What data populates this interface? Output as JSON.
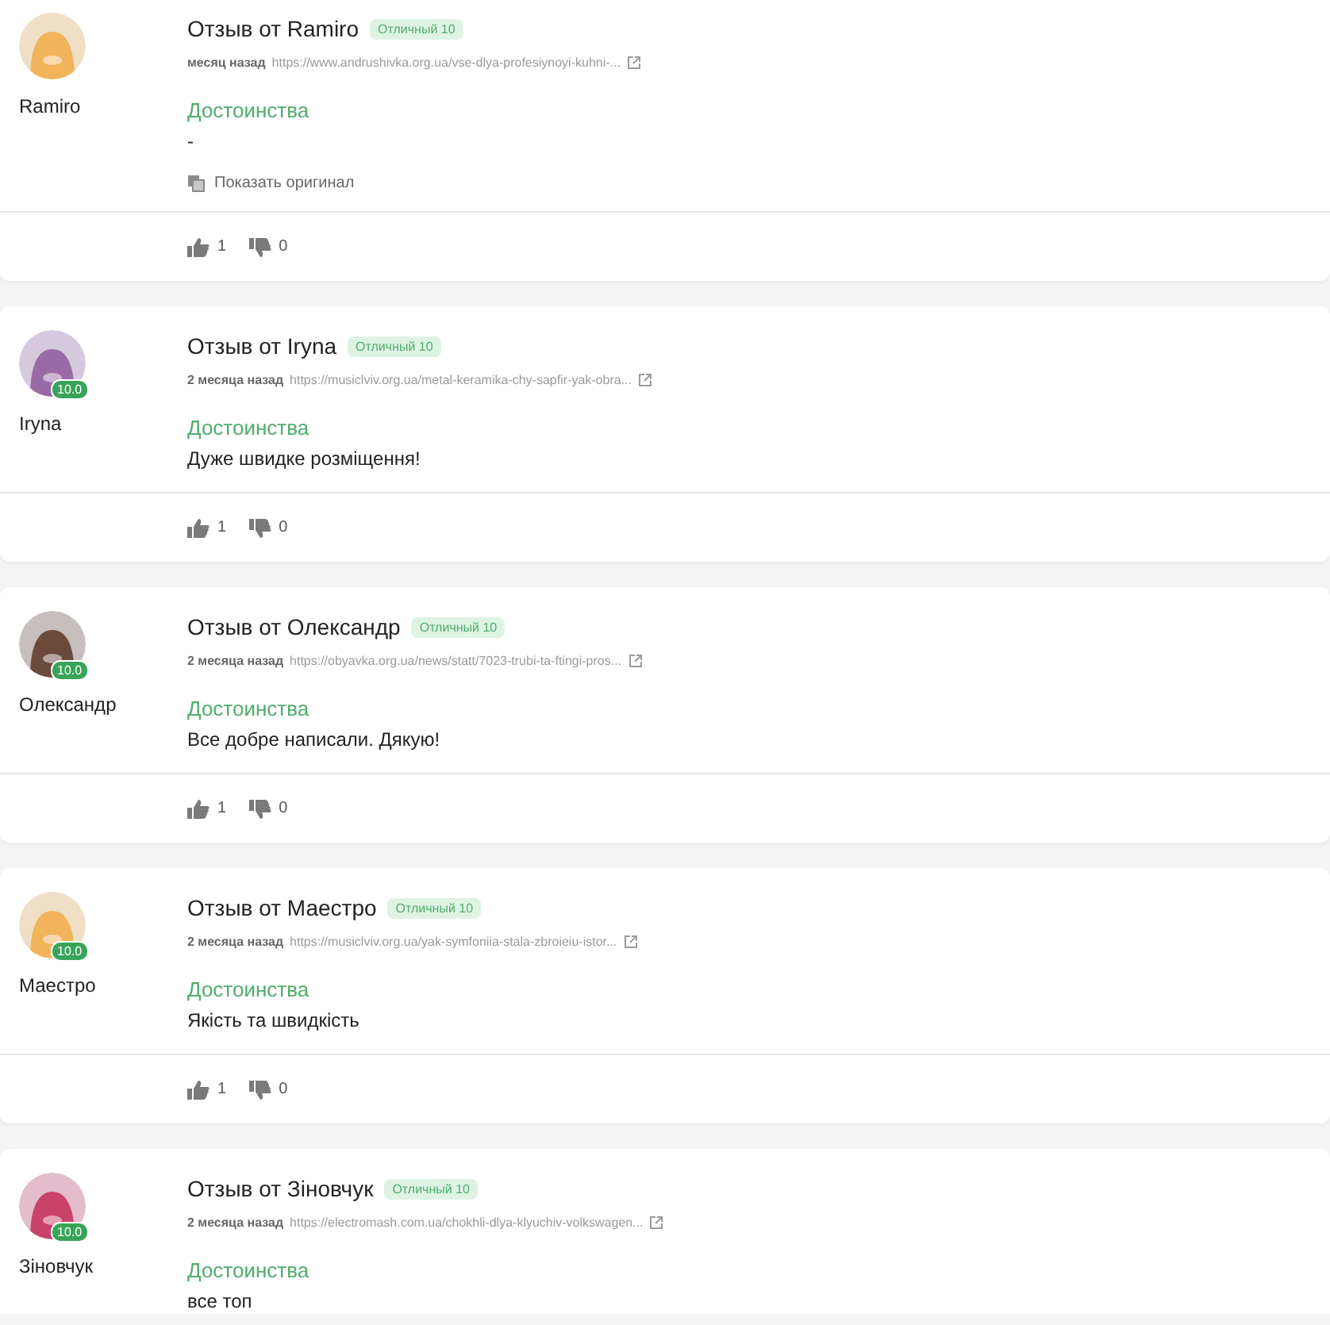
{
  "reviews": [
    {
      "author": "Ramiro",
      "avatar": {
        "color": "#f2b45a"
      },
      "title": "Отзыв от Ramiro",
      "badge": "Отличный 10",
      "time": "месяц назад",
      "url": "https://www.andrushivka.org.ua/vse-dlya-profesiynoyi-kuhni-...",
      "section": "Достоинства",
      "text": "-",
      "show_original": "Показать оригинал",
      "likes": "1",
      "dislikes": "0"
    },
    {
      "author": "Iryna",
      "avatar": {
        "color": "#9a6aa6",
        "score": "10.0"
      },
      "title": "Отзыв от Iryna",
      "badge": "Отличный 10",
      "time": "2 месяца назад",
      "url": "https://musiclviv.org.ua/metal-keramika-chy-sapfir-yak-obra...",
      "section": "Достоинства",
      "text": "Дуже швидке розміщення!",
      "likes": "1",
      "dislikes": "0"
    },
    {
      "author": "Олександр",
      "avatar": {
        "color": "#6a4a3a",
        "score": "10.0"
      },
      "title": "Отзыв от Олександр",
      "badge": "Отличный 10",
      "time": "2 месяца назад",
      "url": "https://obyavka.org.ua/news/statt/7023-trubi-ta-ftingi-pros...",
      "section": "Достоинства",
      "text": "Все добре написали. Дякую!",
      "likes": "1",
      "dislikes": "0"
    },
    {
      "author": "Маестро",
      "avatar": {
        "color": "#f2b45a",
        "score": "10.0"
      },
      "title": "Отзыв от Маестро",
      "badge": "Отличный 10",
      "time": "2 месяца назад",
      "url": "https://musiclviv.org.ua/yak-symfoniia-stala-zbroieiu-istor...",
      "section": "Достоинства",
      "text": "Якість та швидкість",
      "likes": "1",
      "dislikes": "0"
    },
    {
      "author": "Зіновчук",
      "avatar": {
        "color": "#c9426a",
        "score": "10.0"
      },
      "title": "Отзыв от Зіновчук",
      "badge": "Отличный 10",
      "time": "2 месяца назад",
      "url": "https://electromash.com.ua/chokhli-dlya-klyuchiv-volkswagen...",
      "section": "Достоинства",
      "text": "все топ"
    }
  ]
}
